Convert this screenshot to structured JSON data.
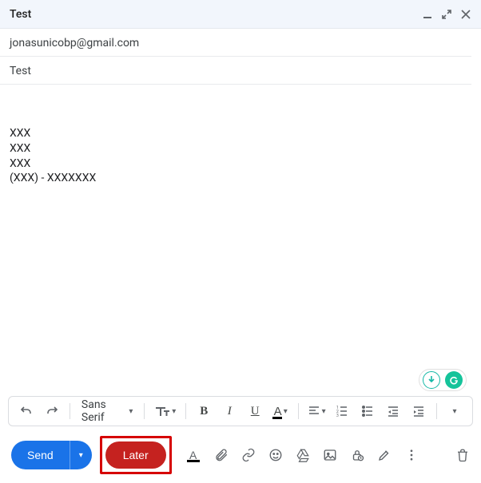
{
  "window": {
    "title": "Test"
  },
  "compose": {
    "to": "jonasunicobp@gmail.com",
    "subject": "Test",
    "body": "\nXXX\nXXX\nXXX\n(XXX) - XXXXXXX"
  },
  "format_bar": {
    "font_name": "Sans Serif"
  },
  "actions": {
    "send_label": "Send",
    "later_label": "Later"
  }
}
